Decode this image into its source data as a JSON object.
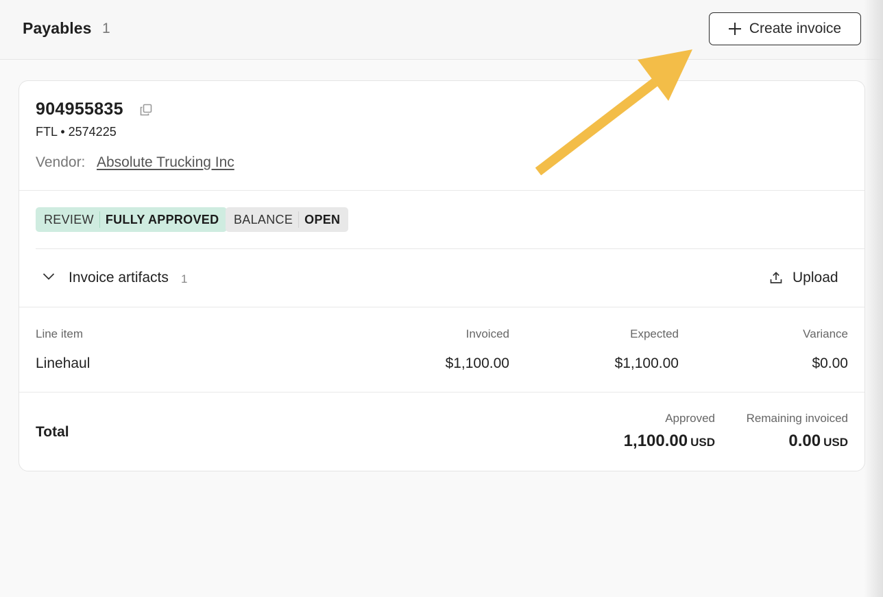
{
  "header": {
    "title": "Payables",
    "count": "1",
    "create_button_label": "Create invoice"
  },
  "payable": {
    "id": "904955835",
    "subtitle": "FTL • 2574225",
    "vendor_label": "Vendor:",
    "vendor_name": "Absolute Trucking Inc",
    "badges": [
      {
        "key": "REVIEW",
        "value": "FULLY APPROVED",
        "color": "#cfece0"
      },
      {
        "key": "BALANCE",
        "value": "OPEN",
        "color": "#e8e8e8"
      }
    ],
    "artifacts": {
      "label": "Invoice artifacts",
      "count": "1",
      "upload_label": "Upload"
    },
    "line_items": {
      "columns": [
        "Line item",
        "Invoiced",
        "Expected",
        "Variance"
      ],
      "rows": [
        {
          "item": "Linehaul",
          "invoiced": "$1,100.00",
          "expected": "$1,100.00",
          "variance": "$0.00"
        }
      ]
    },
    "totals": {
      "label": "Total",
      "approved_label": "Approved",
      "approved_value": "1,100.00",
      "approved_currency": "USD",
      "remaining_label": "Remaining invoiced",
      "remaining_value": "0.00",
      "remaining_currency": "USD"
    }
  },
  "annotation": {
    "arrow_color": "#f3bd48"
  }
}
